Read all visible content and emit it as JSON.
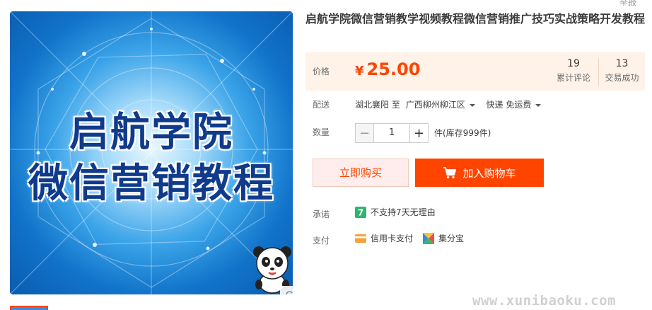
{
  "header": {
    "report_link": "举报"
  },
  "product": {
    "title": "启航学院微信营销教学视频教程微信营销推广技巧实战策略开发教程",
    "image_text": {
      "line1": "启航学院",
      "line2": "微信营销教程"
    }
  },
  "price": {
    "label": "价格",
    "currency": "¥",
    "value": "25.00",
    "accent_color": "#ff4400"
  },
  "stats": [
    {
      "value": "19",
      "label": "累计评论"
    },
    {
      "value": "13",
      "label": "交易成功"
    }
  ],
  "shipping": {
    "label": "配送",
    "from": "湖北襄阳",
    "to_word": "至",
    "destination": "广西柳州柳江区",
    "method": "快递 免运费"
  },
  "quantity": {
    "label": "数量",
    "minus": "−",
    "value": "1",
    "plus": "+",
    "stock": "件(库存999件)"
  },
  "actions": {
    "buy_now": "立即购买",
    "add_to_cart": "加入购物车"
  },
  "promise": {
    "label": "承诺",
    "badge": "7",
    "text": "不支持7天无理由"
  },
  "payment": {
    "label": "支付",
    "methods": [
      "信用卡支付",
      "集分宝"
    ]
  },
  "icons": [
    "zoom-icon",
    "cart-icon",
    "credit-card-icon",
    "jifenbao-icon",
    "panda-mascot-icon"
  ],
  "watermark": "www.xunibaoku.com"
}
